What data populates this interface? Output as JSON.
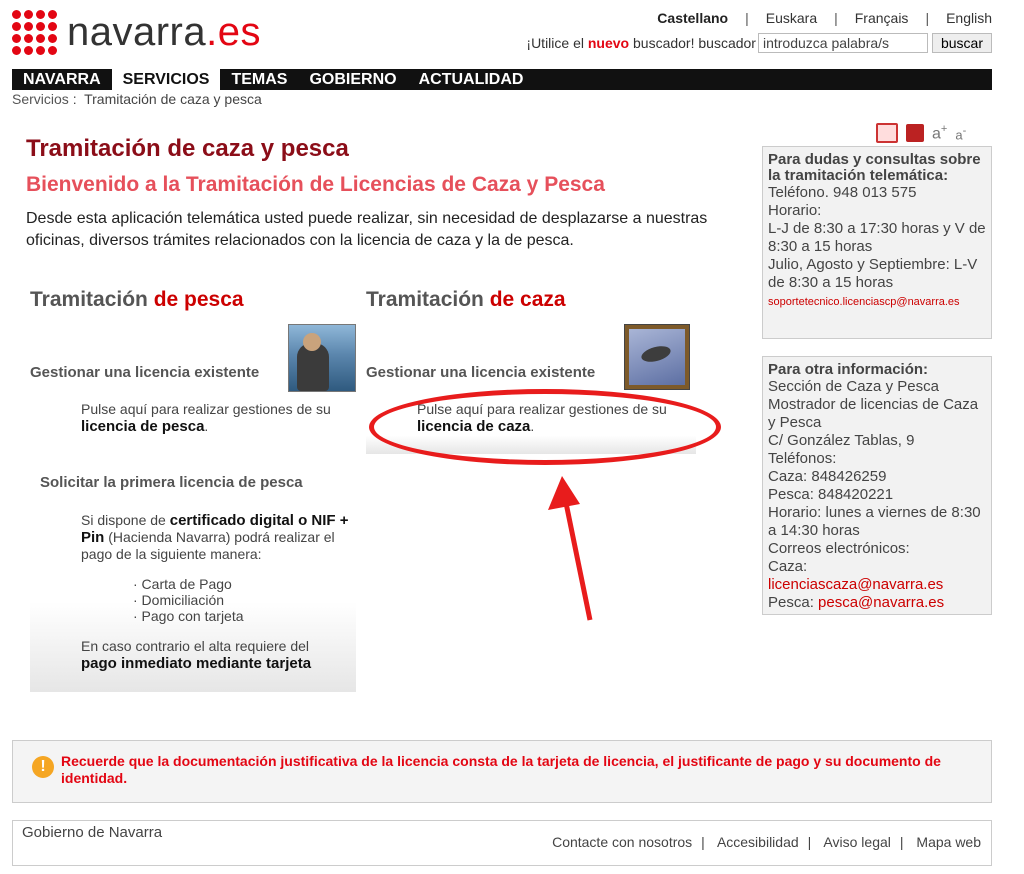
{
  "header": {
    "logo_text": "navarra",
    "logo_suffix": ".es",
    "languages": [
      "Castellano",
      "Euskara",
      "Français",
      "English"
    ],
    "search_prefix": "¡Utilice el ",
    "search_new": "nuevo",
    "search_suffix": " buscador! buscador",
    "search_placeholder": "introduzca palabra/s",
    "search_button": "buscar"
  },
  "nav": {
    "items": [
      "NAVARRA",
      "SERVICIOS",
      "TEMAS",
      "GOBIERNO",
      "ACTUALIDAD"
    ],
    "active": "SERVICIOS"
  },
  "breadcrumb": {
    "link": "Servicios",
    "separator": ":",
    "current": "Tramitación de caza y pesca"
  },
  "tools": {
    "font_up": "a",
    "font_up_sign": "+",
    "font_down": "a",
    "font_down_sign": "-"
  },
  "main": {
    "title": "Tramitación de caza y pesca",
    "subtitle": "Bienvenido a la Tramitación de Licencias de Caza y Pesca",
    "intro": "Desde esta aplicación telemática usted puede realizar, sin necesidad de desplazarse a nuestras oficinas, diversos trámites relacionados con la licencia de caza y la de pesca.",
    "pesca": {
      "title_a": "Tramitación ",
      "title_b": "de pesca",
      "manage": "Gestionar una licencia existente",
      "pulse_text": "Pulse aquí para realizar gestiones de su",
      "pulse_bold": "licencia de pesca",
      "pulse_end": ".",
      "solicitar": "Solicitar la primera licencia de pesca",
      "cert_a": "Si dispone de ",
      "cert_b": "certificado digital o NIF + Pin",
      "cert_c": " (Hacienda Navarra) podrá realizar el pago de la siguiente manera:",
      "options": [
        "· Carta de Pago",
        "· Domiciliación",
        "· Pago con tarjeta"
      ],
      "contrario_a": "En caso contrario el alta requiere del",
      "contrario_b": "pago inmediato mediante tarjeta"
    },
    "caza": {
      "title_a": "Tramitación ",
      "title_b": "de caza",
      "manage": "Gestionar una licencia existente",
      "pulse_text": "Pulse aquí para realizar gestiones de su",
      "pulse_bold": "licencia de caza",
      "pulse_end": "."
    }
  },
  "sidebar": {
    "box1": {
      "title": "Para dudas y consultas sobre la tramitación telemática:",
      "phone": "Teléfono. 948 013 575",
      "hours_label": "Horario:",
      "hours_1": "L-J de 8:30 a 17:30 horas y V de 8:30 a 15 horas",
      "hours_2": "Julio, Agosto y Septiembre: L-V de 8:30 a 15 horas",
      "email": "soportetecnico.licenciascp@navarra.es"
    },
    "box2": {
      "title": "Para otra información:",
      "line1": "Sección de Caza y Pesca",
      "line2": "Mostrador de licencias de Caza y Pesca",
      "line3": "C/ González Tablas, 9",
      "line4": "Teléfonos:",
      "line5": "Caza: 848426259",
      "line6": "Pesca: 848420221",
      "line7": "Horario: lunes a viernes de 8:30 a 14:30 horas",
      "line8": "Correos electrónicos:",
      "caza_label": "Caza: ",
      "caza_email": "licenciascaza@navarra.es",
      "pesca_label": "Pesca: ",
      "pesca_email": "pesca@navarra.es"
    }
  },
  "notice": {
    "icon": "!",
    "text": "Recuerde que la documentación justificativa de la licencia consta de la tarjeta de licencia, el justificante de pago y su documento de identidad."
  },
  "footer": {
    "gov": "Gobierno de Navarra",
    "links": [
      "Contacte con nosotros",
      "Accesibilidad",
      "Aviso legal",
      "Mapa web"
    ],
    "separator": "|"
  },
  "colors": {
    "brand_red": "#e30613",
    "title_dark_red": "#8b0d18",
    "subtitle_red": "#e6505b",
    "annotation_red": "#e81c1c"
  }
}
